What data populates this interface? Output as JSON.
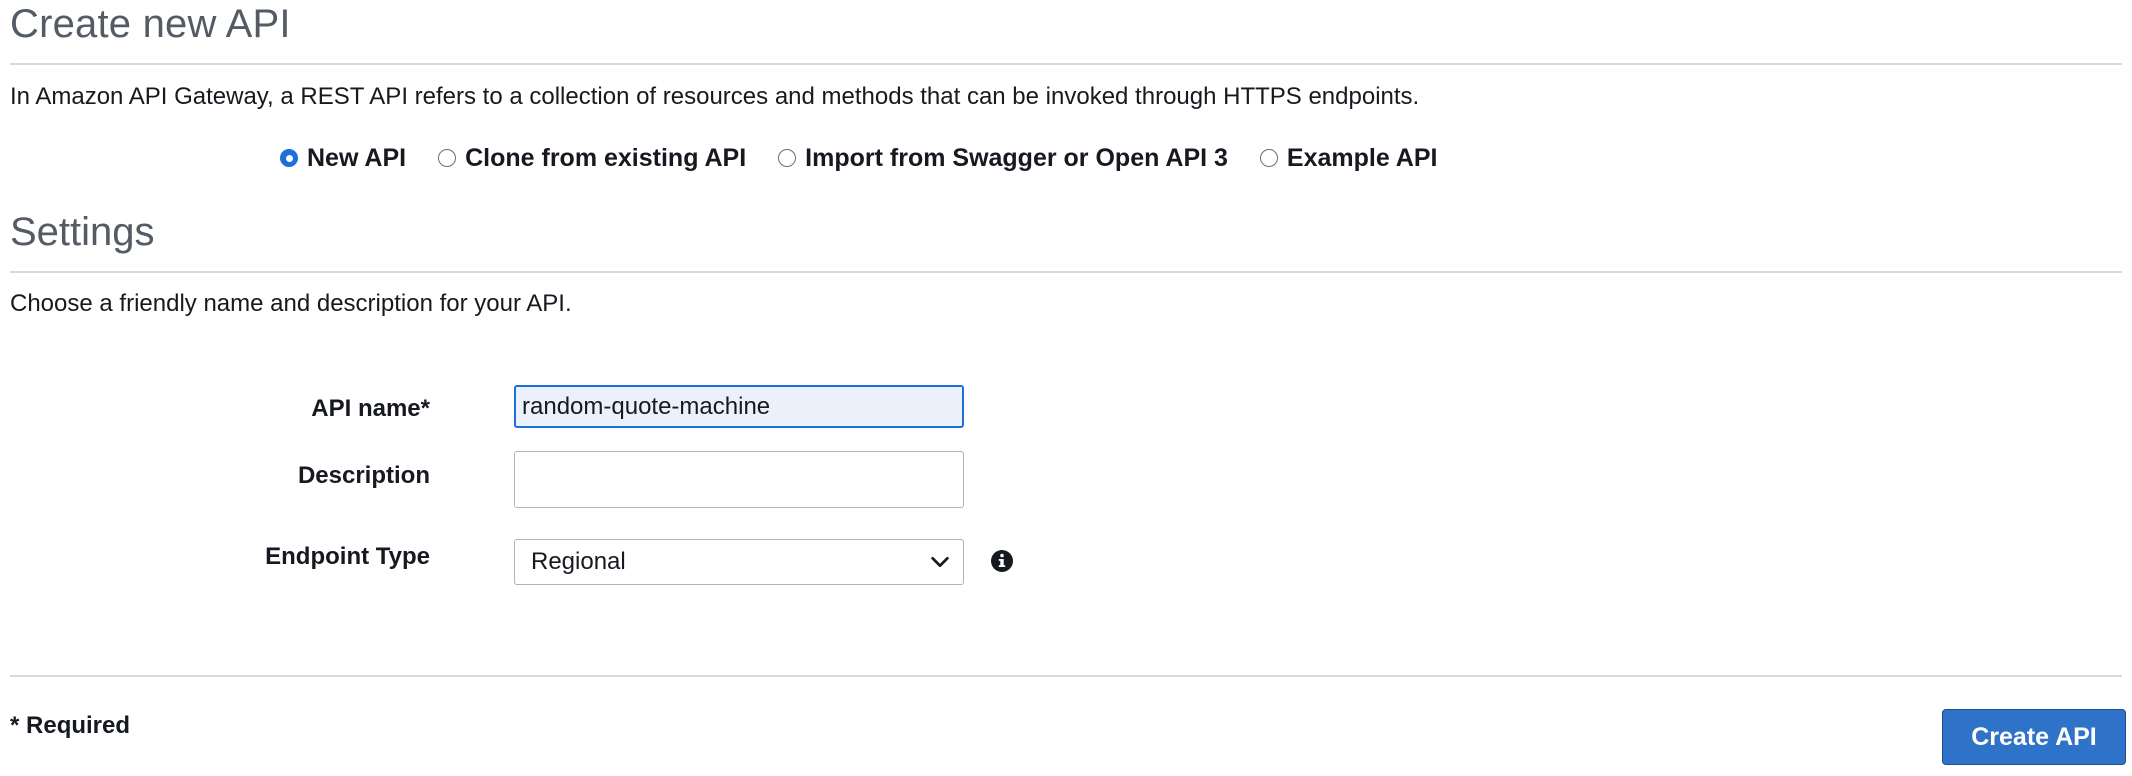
{
  "header": {
    "title": "Create new API",
    "intro": "In Amazon API Gateway, a REST API refers to a collection of resources and methods that can be invoked through HTTPS endpoints."
  },
  "api_source": {
    "options": [
      {
        "label": "New API",
        "selected": true
      },
      {
        "label": "Clone from existing API",
        "selected": false
      },
      {
        "label": "Import from Swagger or Open API 3",
        "selected": false
      },
      {
        "label": "Example API",
        "selected": false
      }
    ]
  },
  "settings": {
    "title": "Settings",
    "subtitle": "Choose a friendly name and description for your API.",
    "api_name": {
      "label": "API name*",
      "value": "random-quote-machine"
    },
    "description": {
      "label": "Description",
      "value": ""
    },
    "endpoint_type": {
      "label": "Endpoint Type",
      "value": "Regional"
    }
  },
  "footer": {
    "required_note": "* Required",
    "create_label": "Create API"
  },
  "colors": {
    "accent": "#1e6fd9",
    "button": "#2f73c9",
    "heading": "#545b64",
    "rule": "#d5dbdb",
    "active_input_bg": "#eaf1fb"
  },
  "icons": {
    "select_chevron": "chevron-down-icon",
    "info": "info-icon"
  }
}
